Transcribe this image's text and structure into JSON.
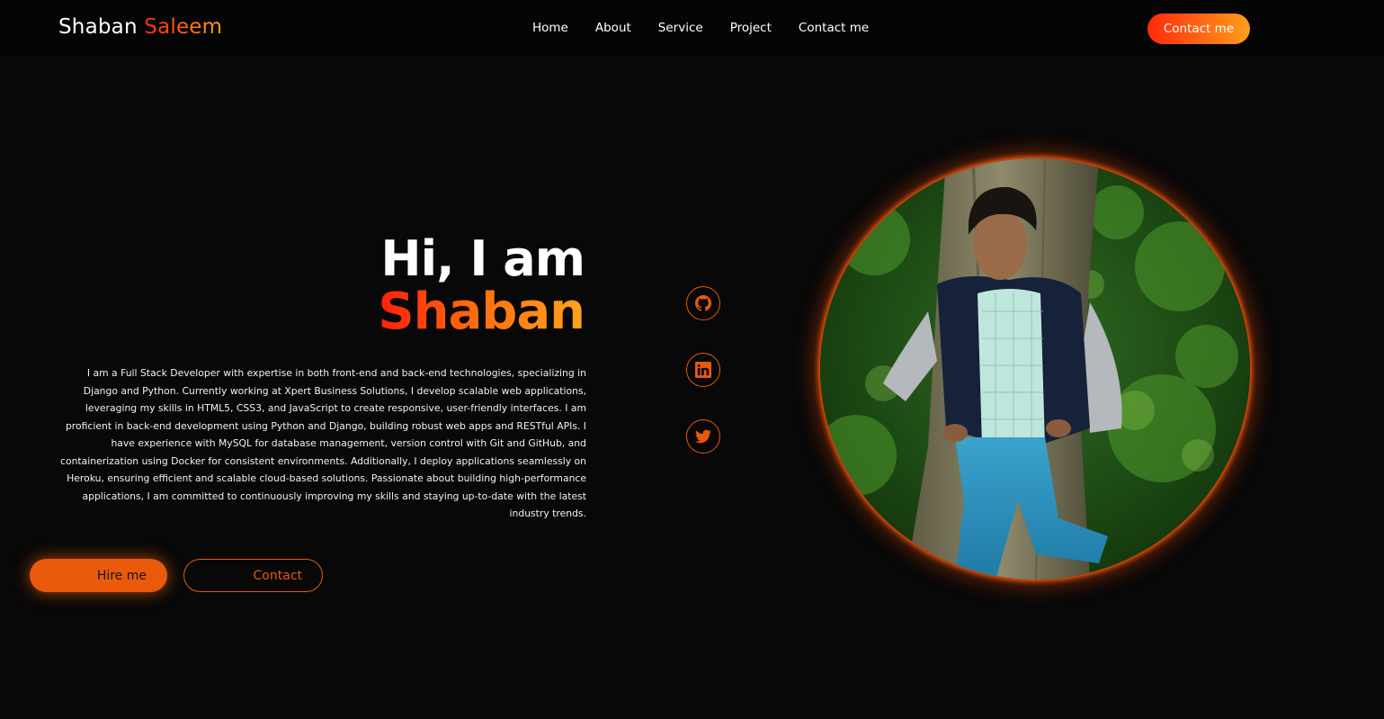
{
  "header": {
    "logo_first": "Shaban",
    "logo_last": "Saleem",
    "nav": [
      "Home",
      "About",
      "Service",
      "Project",
      "Contact me"
    ],
    "cta_label": "Contact me"
  },
  "hero": {
    "greeting": "Hi, I am",
    "name": "Shaban",
    "bio": "I am a Full Stack Developer with expertise in both front-end and back-end technologies, specializing in Django and Python. Currently working at Xpert Business Solutions, I develop scalable web applications, leveraging my skills in HTML5, CSS3, and JavaScript to create responsive, user-friendly interfaces. I am proficient in back-end development using Python and Django, building robust web apps and RESTful APIs. I have experience with MySQL for database management, version control with Git and GitHub, and containerization using Docker for consistent environments. Additionally, I deploy applications seamlessly on Heroku, ensuring efficient and scalable cloud-based solutions. Passionate about building high-performance applications, I am committed to continuously improving my skills and staying up-to-date with the latest industry trends.",
    "hire_label": "Hire me",
    "contact_label": "Contact"
  },
  "social": [
    {
      "icon": "github-icon"
    },
    {
      "icon": "linkedin-icon"
    },
    {
      "icon": "twitter-icon"
    }
  ],
  "colors": {
    "background": "#080808",
    "accent": "#ea5a0d",
    "gradient_start": "#ff2a0a",
    "gradient_end": "#ff9e1a"
  }
}
